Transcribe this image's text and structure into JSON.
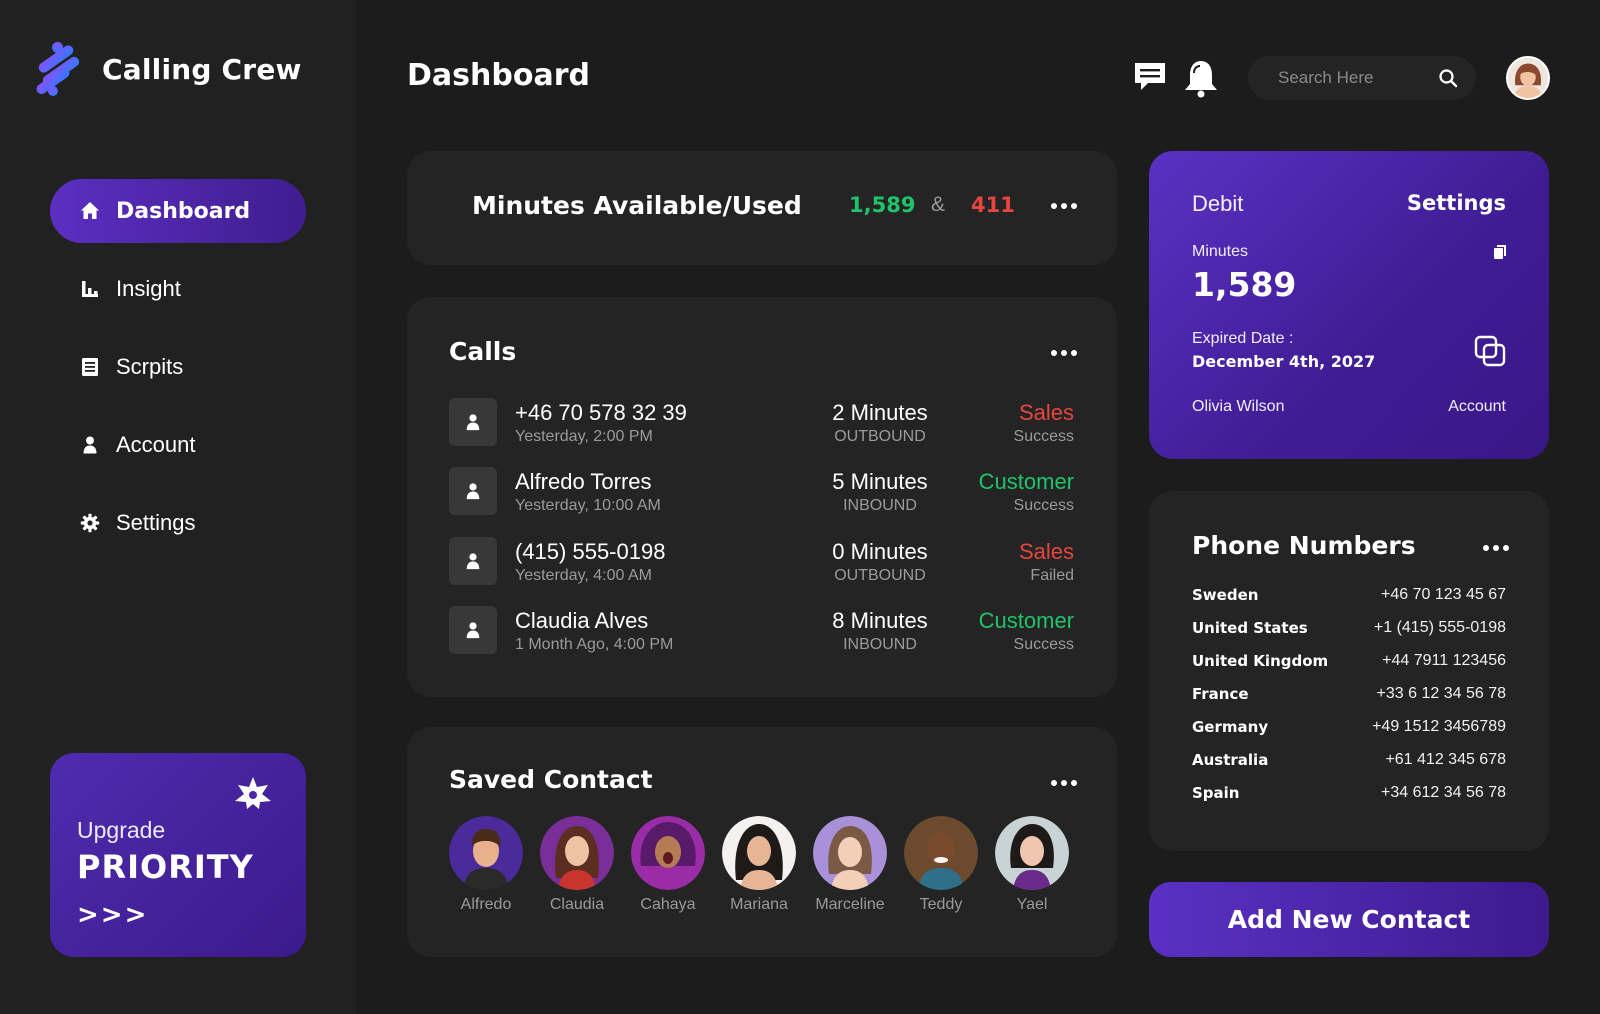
{
  "app": {
    "name": "Calling Crew"
  },
  "sidebar": {
    "items": [
      {
        "label": "Dashboard",
        "icon": "home-icon",
        "active": true
      },
      {
        "label": "Insight",
        "icon": "bar-chart-icon"
      },
      {
        "label": "Scrpits",
        "icon": "document-icon"
      },
      {
        "label": "Account",
        "icon": "user-icon"
      },
      {
        "label": "Settings",
        "icon": "gear-icon"
      }
    ],
    "upgrade": {
      "small": "Upgrade",
      "big": "PRIORITY",
      "arrows": ">>>"
    }
  },
  "header": {
    "title": "Dashboard",
    "search_placeholder": "Search Here",
    "icons": [
      "chat-icon",
      "bell-icon",
      "search-icon",
      "avatar"
    ]
  },
  "minutes": {
    "title": "Minutes Available/Used",
    "available": "1,589",
    "separator": "&",
    "used": "411"
  },
  "calls": {
    "title": "Calls",
    "rows": [
      {
        "name": "+46 70 578 32 39",
        "time": "Yesterday, 2:00 PM",
        "duration": "2 Minutes",
        "direction": "OUTBOUND",
        "type": "Sales",
        "status": "Success"
      },
      {
        "name": "Alfredo Torres",
        "time": "Yesterday, 10:00 AM",
        "duration": "5 Minutes",
        "direction": "INBOUND",
        "type": "Customer",
        "status": "Success"
      },
      {
        "name": "(415) 555-0198",
        "time": "Yesterday, 4:00 AM",
        "duration": "0 Minutes",
        "direction": "OUTBOUND",
        "type": "Sales",
        "status": "Failed"
      },
      {
        "name": "Claudia Alves",
        "time": "1 Month Ago, 4:00 PM",
        "duration": "8 Minutes",
        "direction": "INBOUND",
        "type": "Customer",
        "status": "Success"
      }
    ]
  },
  "saved_contacts": {
    "title": "Saved Contact",
    "contacts": [
      "Alfredo",
      "Claudia",
      "Cahaya",
      "Mariana",
      "Marceline",
      "Teddy",
      "Yael"
    ]
  },
  "debit": {
    "label": "Debit",
    "settings": "Settings",
    "minutes_label": "Minutes",
    "minutes": "1,589",
    "expired_label": "Expired Date :",
    "expired_date": "December  4th, 2027",
    "name": "Olivia Wilson",
    "account": "Account"
  },
  "phone_numbers": {
    "title": "Phone Numbers",
    "rows": [
      {
        "country": "Sweden",
        "number": "+46 70 123 45 67"
      },
      {
        "country": "United States",
        "number": "+1 (415) 555-0198"
      },
      {
        "country": "United Kingdom",
        "number": "+44 7911 123456"
      },
      {
        "country": "France",
        "number": "+33 6 12 34 56 78"
      },
      {
        "country": "Germany",
        "number": "+49 1512 3456789"
      },
      {
        "country": "Australia",
        "number": "+61 412 345 678"
      },
      {
        "country": "Spain",
        "number": "+34 612 34 56 78"
      }
    ]
  },
  "add_contact_label": "Add New Contact",
  "colors": {
    "accent": "#5a31c4",
    "green": "#1fc46a",
    "red": "#e8453f",
    "background": "#1c1c1c",
    "card": "#242424"
  }
}
